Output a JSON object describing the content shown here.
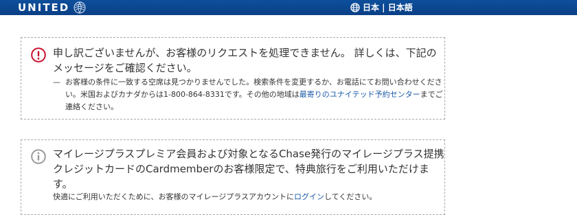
{
  "header": {
    "logo_text": "UNITED",
    "language": "日本 | 日本語",
    "globe_icon": "globe-icon"
  },
  "error_notice": {
    "icon": "error-exclamation-icon",
    "accent_color": "#c8102e",
    "headline": "申し訳ございませんが、お客様のリクエストを処理できません。 詳しくは、下記のメッセージをご確認ください。",
    "dash": "—",
    "detail_before": "お客様の条件に一致する空席は見つかりませんでした。検索条件を変更するか、お電話にてお問い合わせください。米国およびカナダからは1-800-864-8331です。その他の地域は",
    "detail_link": "最寄りのユナイテッド予約センター",
    "detail_after": "までご連絡ください。"
  },
  "info_notice": {
    "icon": "info-icon",
    "headline": "マイレージプラスプレミア会員および対象となるChase発行のマイレージプラス提携クレジットカードのCardmemberのお客様限定で、特典旅行をご利用いただけます。",
    "sub_before": "快適にご利用いただくために、お客様のマイレージプラスアカウントに",
    "sub_link": "ログイン",
    "sub_after": "してください。"
  }
}
